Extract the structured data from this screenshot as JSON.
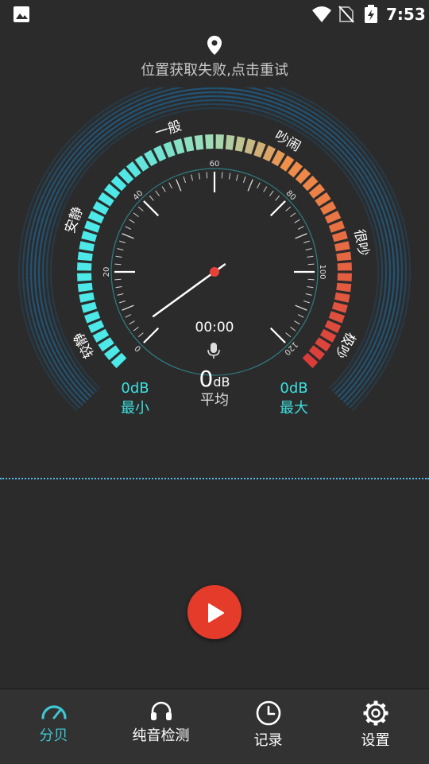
{
  "status_bar": {
    "time": "7:53",
    "icons": [
      "gallery-icon",
      "wifi-icon",
      "no-sim-icon",
      "battery-charging-icon"
    ]
  },
  "location": {
    "text": "位置获取失败,点击重试",
    "icon": "location-pin-icon"
  },
  "gauge": {
    "zones": {
      "very_quiet": "较静",
      "quiet": "安静",
      "normal": "一般",
      "noisy": "吵闹",
      "very_noisy": "很吵",
      "extreme": "极吵"
    },
    "ticks": [
      "0",
      "20",
      "40",
      "60",
      "80",
      "100",
      "120"
    ],
    "needle_value": 4,
    "timer": "00:00",
    "average_value": "0",
    "average_unit": "dB",
    "average_label": "平均",
    "min_value": "0dB",
    "min_label": "最小",
    "max_value": "0dB",
    "max_label": "最大",
    "colors": {
      "low": "#4de8e8",
      "mid": "#a3dcb4",
      "high": "#f0904a",
      "top": "#d93a3a",
      "accent": "#3ec7d2"
    }
  },
  "record_button": {
    "icon": "play-icon"
  },
  "nav": {
    "items": [
      {
        "label": "分贝",
        "icon": "gauge-icon",
        "active": true
      },
      {
        "label": "纯音检测",
        "icon": "headphones-icon",
        "active": false
      },
      {
        "label": "记录",
        "icon": "clock-icon",
        "active": false
      },
      {
        "label": "设置",
        "icon": "gear-icon",
        "active": false
      }
    ]
  }
}
